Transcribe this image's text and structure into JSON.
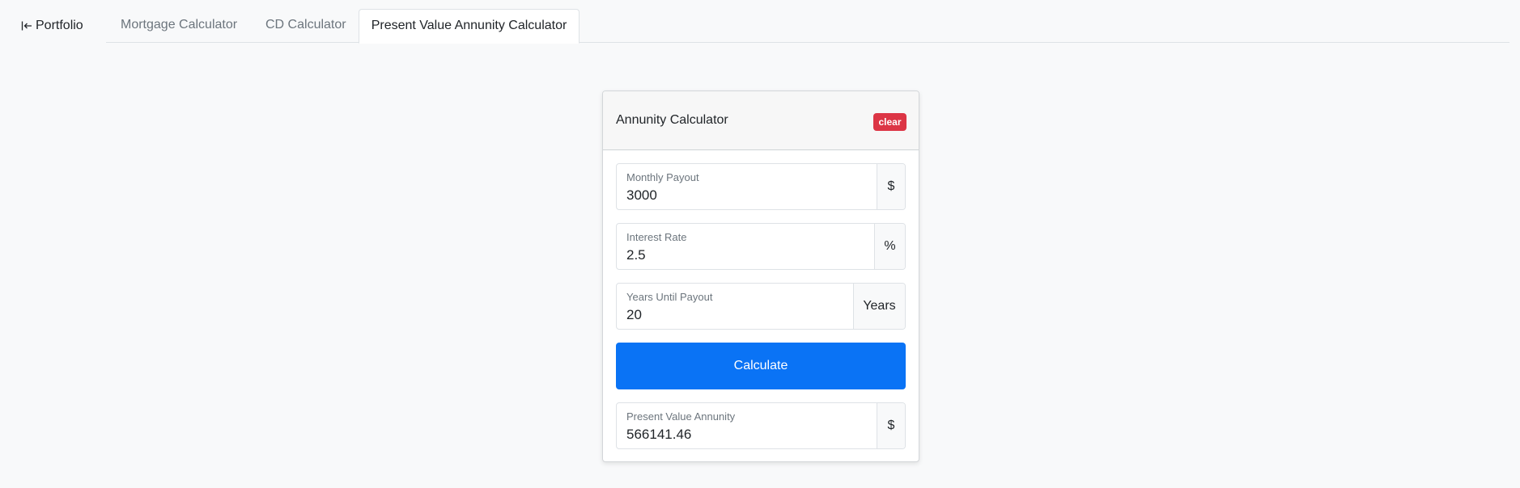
{
  "nav": {
    "back_label": "Portfolio",
    "back_icon": "arrow-left-bar-icon",
    "tabs": [
      {
        "label": "Mortgage Calculator",
        "active": false
      },
      {
        "label": "CD Calculator",
        "active": false
      },
      {
        "label": "Present Value Annunity Calculator",
        "active": true
      }
    ]
  },
  "card": {
    "title": "Annunity Calculator",
    "clear_label": "clear",
    "fields": [
      {
        "label": "Monthly Payout",
        "value": "3000",
        "addon": "$"
      },
      {
        "label": "Interest Rate",
        "value": "2.5",
        "addon": "%"
      },
      {
        "label": "Years Until Payout",
        "value": "20",
        "addon": "Years"
      }
    ],
    "calculate_label": "Calculate",
    "result": {
      "label": "Present Value Annunity",
      "value": "566141.46",
      "addon": "$"
    }
  },
  "colors": {
    "primary": "#0a73f5",
    "danger": "#dc3545",
    "background": "#f8f9fa"
  }
}
